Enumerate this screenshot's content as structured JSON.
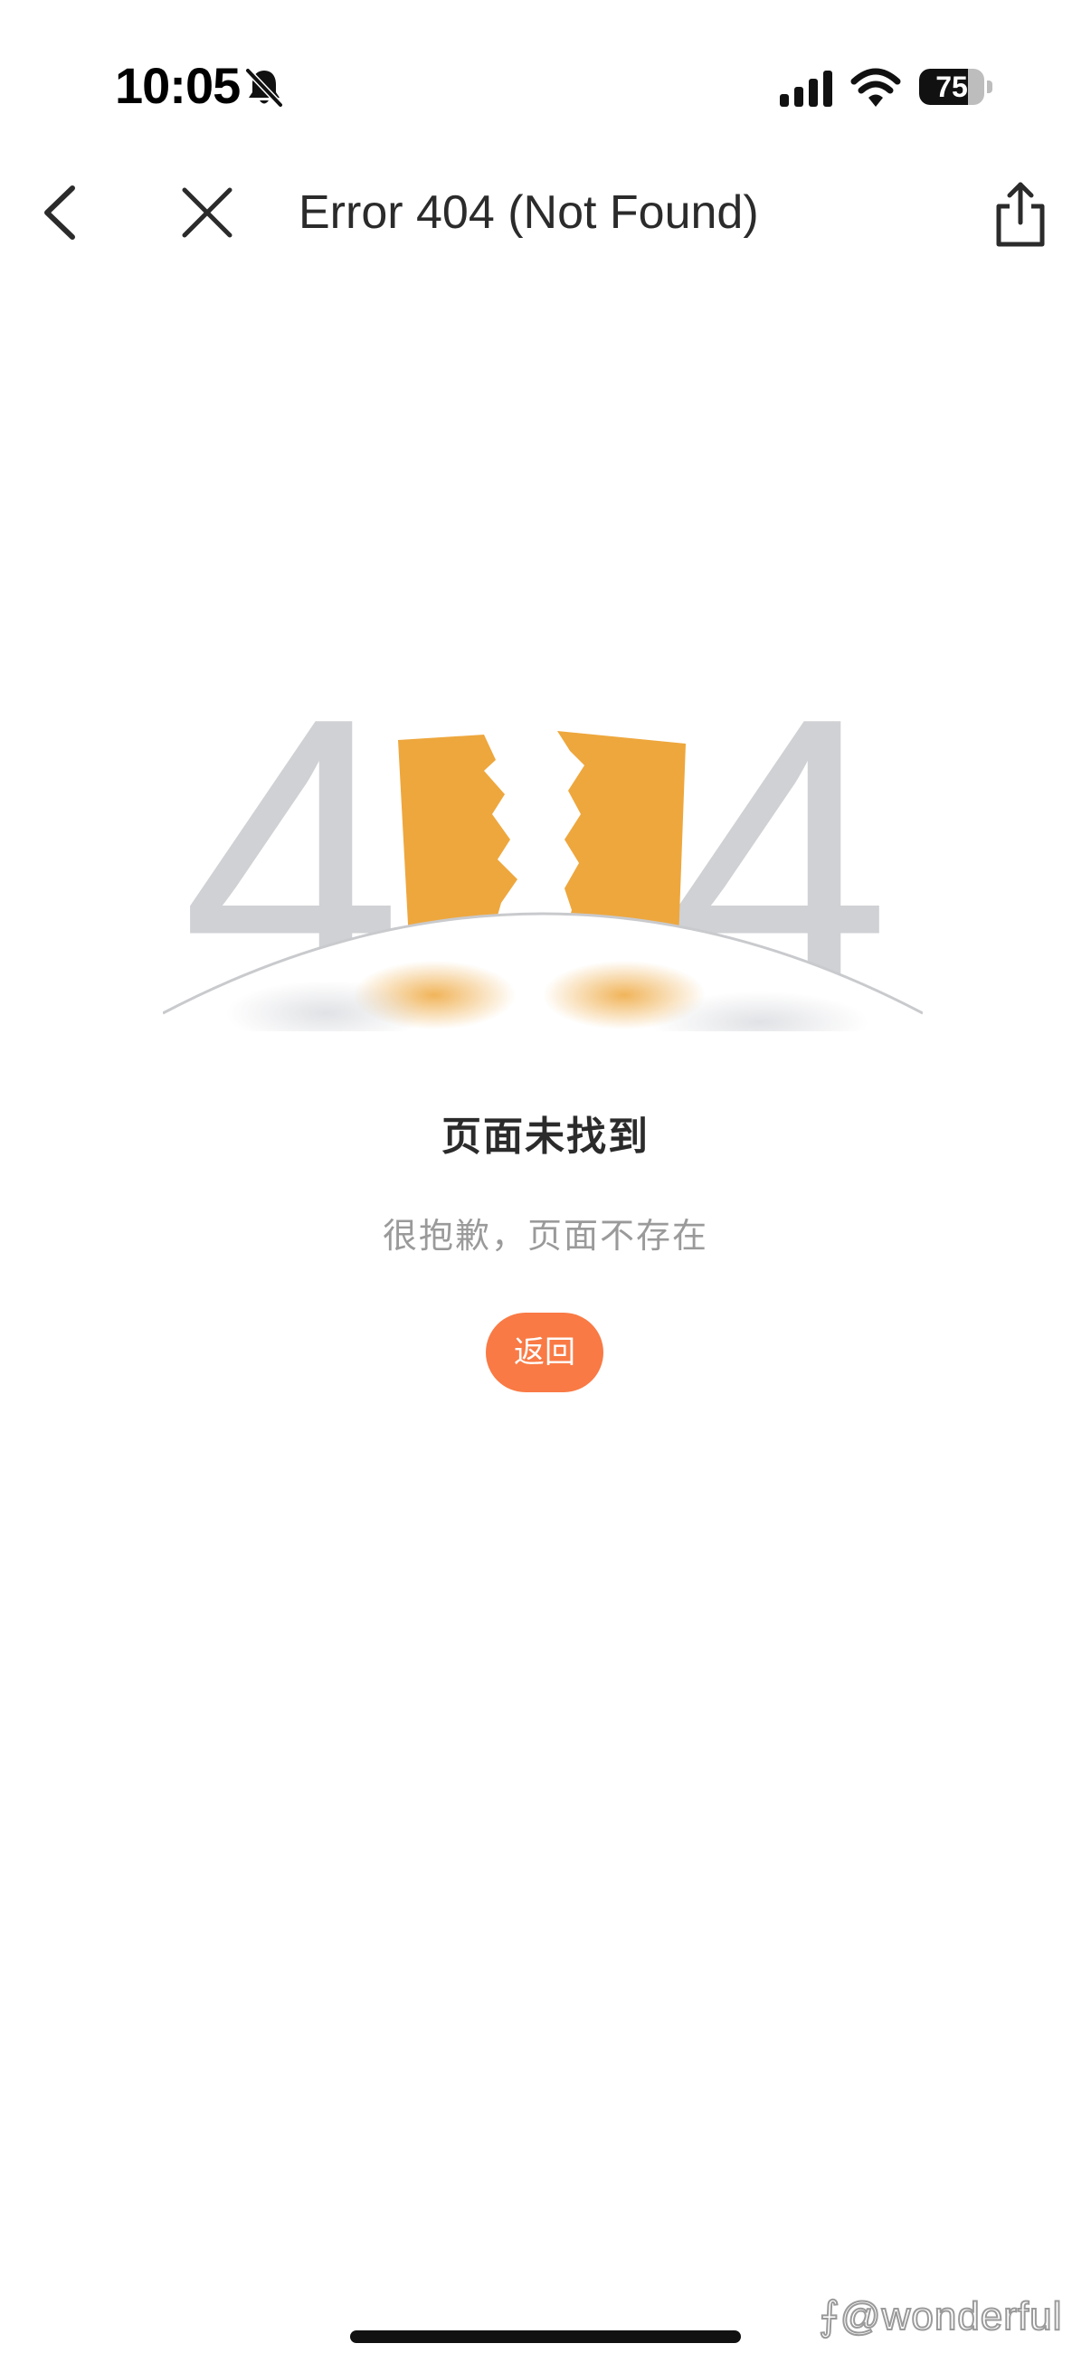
{
  "status_bar": {
    "time": "10:05",
    "battery": "75",
    "battery_level": 0.75,
    "icons": [
      "bell-slash-icon",
      "cellular-signal-icon",
      "wifi-icon",
      "battery-icon"
    ]
  },
  "nav": {
    "title": "Error 404 (Not Found)",
    "back_icon": "chevron-left-icon",
    "close_icon": "close-icon",
    "share_icon": "share-icon"
  },
  "illustration": {
    "left_digit": "4",
    "right_digit": "4",
    "digit_color": "#d0d1d4",
    "block_color": "#eea73d"
  },
  "content": {
    "title": "页面未找到",
    "description": "很抱歉，页面不存在",
    "back_button_label": "返回",
    "accent_color": "#f97a45"
  },
  "watermark": "⨍@wonderful"
}
